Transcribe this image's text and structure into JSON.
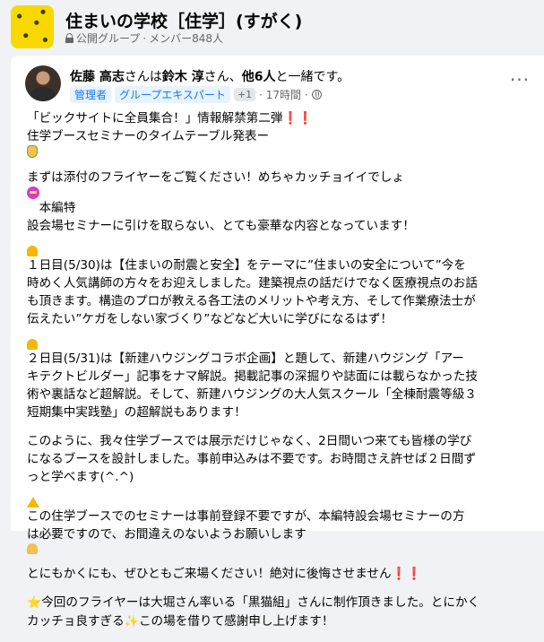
{
  "group": {
    "name": "住まいの学校［住学］(すがく)",
    "privacy": "公開グループ",
    "separator": "·",
    "members": "メンバー848人"
  },
  "post": {
    "author": "佐藤 高志",
    "with_text": "さんは",
    "tagged1": "鈴木 淳",
    "tagged_mid": "さん、",
    "others": "他6人",
    "with_suffix": "と一緒です。",
    "badge_admin": "管理者",
    "badge_expert": "グループエキスパート",
    "badge_more": "+1",
    "time": "· 17時間 ·",
    "more": "···",
    "body": {
      "l1": "「ビックサイトに全員集合！」情報解禁第二弾",
      "l2": "住学ブースセミナーのタイムテーブル発表ー",
      "p2a": "まずは添付のフライヤーをご覧ください！めちゃカッチョイイでしょ",
      "p2a_tail": "　本編特",
      "p2b": "設会場セミナーに引けを取らない、とても豪華な内容となっています！",
      "p3a": "１日目(5/30)は【住まいの耐震と安全】をテーマに”住まいの安全について”今を",
      "p3b": "時めく人気講師の方々をお迎えしました。建築視点の話だけでなく医療視点のお話",
      "p3c": "も頂きます。構造のプロが教える各工法のメリットや考え方、そして作業療法士が",
      "p3d": "伝えたい”ケガをしない家づくり”などなど大いに学びになるはず！",
      "p4a": "２日目(5/31)は【新建ハウジングコラボ企画】と題して、新建ハウジング「アー",
      "p4b": "キテクトビルダー」記事をナマ解説。掲載記事の深掘りや誌面には載らなかった技",
      "p4c": "術や裏話など超解説。そして、新建ハウジングの大人気スクール「全棟耐震等級３",
      "p4d": "短期集中実践塾」の超解説もあります！",
      "p5a": "このように、我々住学ブースでは展示だけじゃなく、2日間いつ来ても皆様の学び",
      "p5b": "になるブースを設計しました。事前申込みは不要です。お時間さえ許せば２日間ず",
      "p5c": "っと学べます(^.^)",
      "p6a": "この住学ブースでのセミナーは事前登録不要ですが、本編特設会場セミナーの方",
      "p6b": "は必要ですので、お間違えのないようお願いします",
      "p7": "とにもかくにも、ぜひともご来場ください！絶対に後悔させません",
      "p8a": "今回のフライヤーは大堀さん率いる「黒猫組」さんに制作頂きました。とにかく",
      "p8b": "カッチョ良すぎる",
      "p8b_tail": "この場を借りて感謝申し上げます！",
      "exclaim": "❗❗",
      "sparkle": "✨",
      "star": "⭐"
    }
  }
}
